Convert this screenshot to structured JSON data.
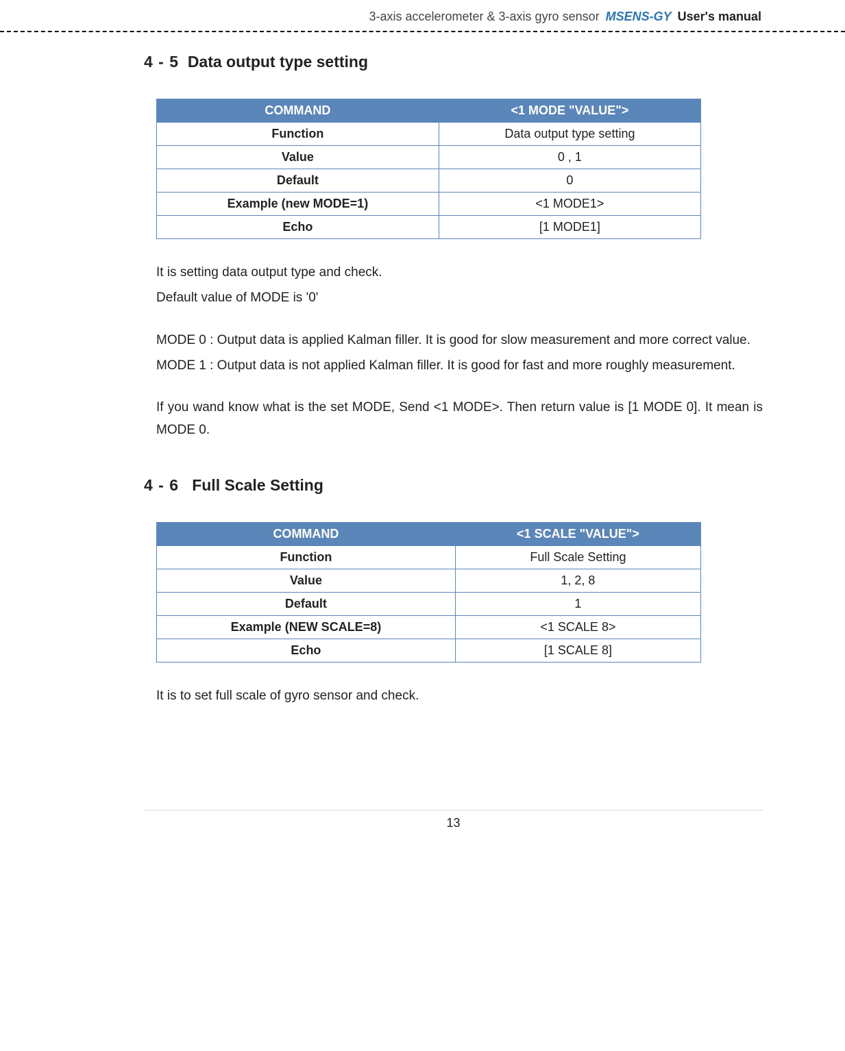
{
  "header": {
    "plain": "3-axis accelerometer & 3-axis gyro sensor",
    "product": "MSENS-GY",
    "bold": "User's manual"
  },
  "section45": {
    "number": "4 - 5",
    "title": "Data output type setting",
    "table": {
      "hdr_left": "COMMAND",
      "hdr_right": "<1 MODE \"VALUE\">",
      "rows": [
        {
          "label": "Function",
          "value": "Data output type setting"
        },
        {
          "label": "Value",
          "value": "0 , 1"
        },
        {
          "label": "Default",
          "value": "0"
        },
        {
          "label": "Example (new MODE=1)",
          "value": "<1 MODE1>"
        },
        {
          "label": "Echo",
          "value": "[1 MODE1]"
        }
      ]
    },
    "para_a1": "It is setting data output type and check.",
    "para_a2": "Default value of MODE is '0'",
    "para_b1": "MODE   0 : Output data is applied Kalman filler. It is good for slow measurement and more correct value.",
    "para_b2": "MODE   1 : Output data is not applied Kalman filler. It is good for fast and more roughly measurement.",
    "para_c1": "If you wand know what is the set MODE, Send <1 MODE>. Then return value is [1 MODE 0]. It mean is MODE 0."
  },
  "section46": {
    "number": "4 - 6",
    "title": "Full Scale Setting",
    "table": {
      "hdr_left": "COMMAND",
      "hdr_right": "<1 SCALE \"VALUE\">",
      "rows": [
        {
          "label": "Function",
          "value": "Full Scale Setting"
        },
        {
          "label": "Value",
          "value": "1, 2, 8"
        },
        {
          "label": "Default",
          "value": "1"
        },
        {
          "label": "Example (NEW SCALE=8)",
          "value": "<1 SCALE 8>"
        },
        {
          "label": "Echo",
          "value": "[1 SCALE 8]"
        }
      ]
    },
    "para_a1": "It is to set full scale of gyro sensor and check."
  },
  "page_number": "13"
}
